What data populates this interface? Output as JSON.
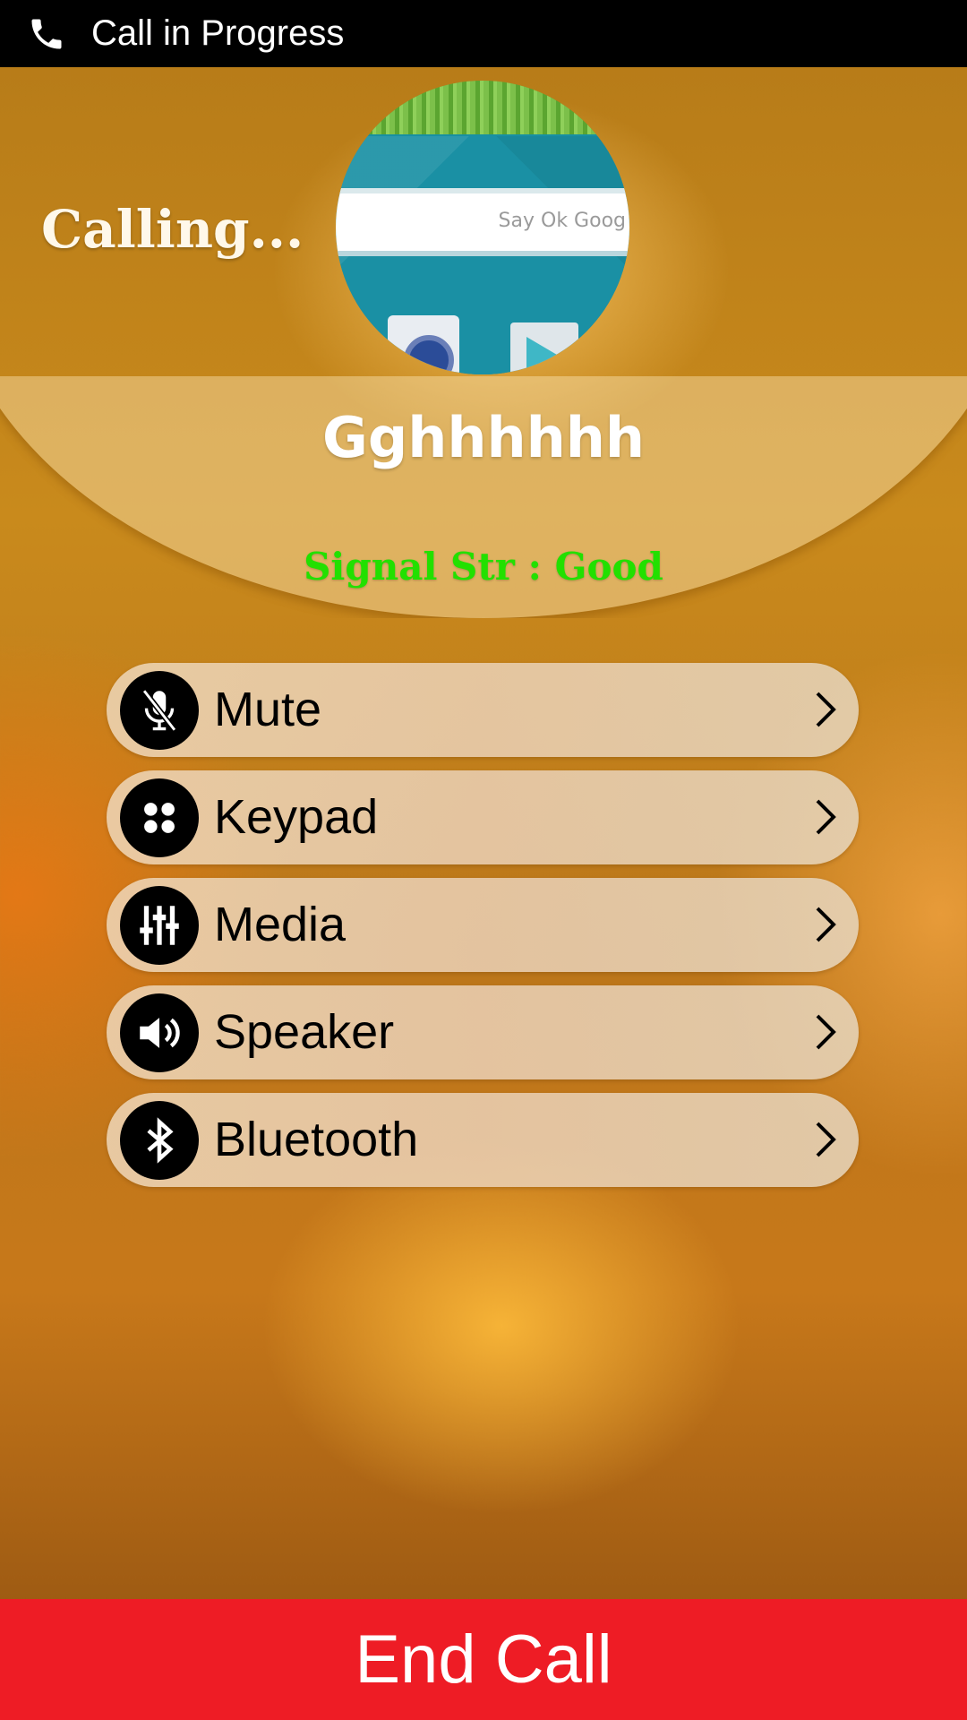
{
  "status_bar": {
    "title": "Call in Progress",
    "icon": "phone-icon"
  },
  "call": {
    "status_text": "Calling...",
    "contact_name": "Gghhhhhh",
    "signal_text": "Signal Str : Good",
    "avatar_search_hint": "Say Ok Goog"
  },
  "options": [
    {
      "label": "Mute",
      "icon": "mic-off-icon"
    },
    {
      "label": "Keypad",
      "icon": "keypad-icon"
    },
    {
      "label": "Media",
      "icon": "equalizer-icon"
    },
    {
      "label": "Speaker",
      "icon": "speaker-icon"
    },
    {
      "label": "Bluetooth",
      "icon": "bluetooth-icon"
    }
  ],
  "end_call": {
    "label": "End Call"
  },
  "colors": {
    "status_bar_bg": "#000000",
    "signal_text": "#22e000",
    "end_call_bg": "#ee1c25"
  }
}
